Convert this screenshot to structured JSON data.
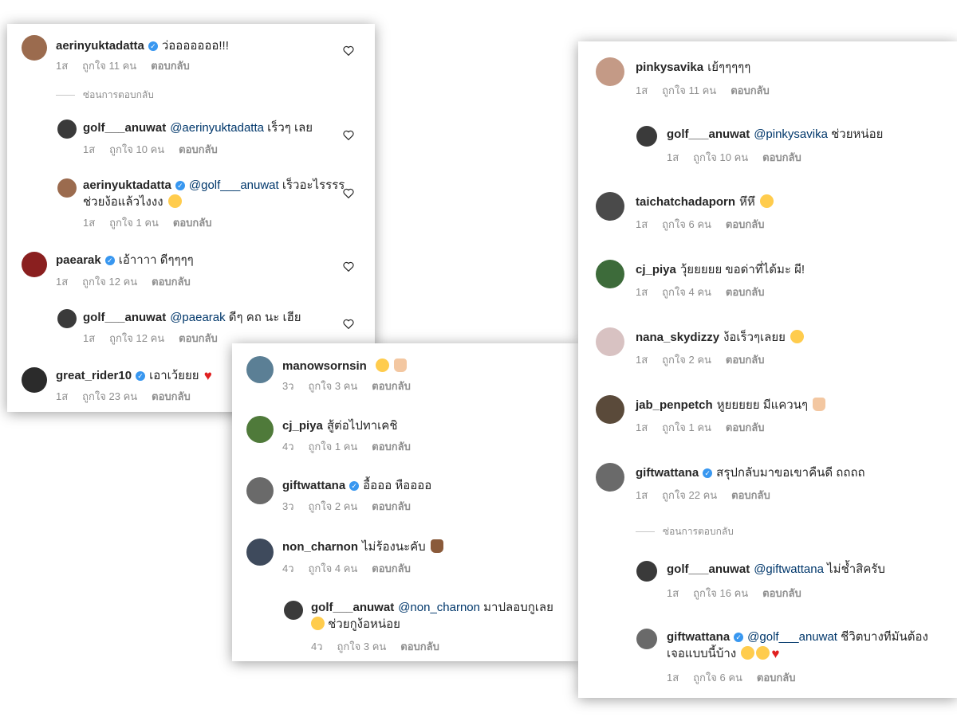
{
  "colors": {
    "verified": "#3897f0",
    "mention": "#00376b",
    "meta": "#8e8e8e",
    "heart_red": "#e02020"
  },
  "panel_a": {
    "c1": {
      "user": "aerinyuktadatta",
      "text": "ว่อออออออ!!!",
      "time": "1ส",
      "likes": "ถูกใจ 11 คน",
      "reply": "ตอบกลับ"
    },
    "hide_replies": "ซ่อนการตอบกลับ",
    "c2": {
      "user": "golf___anuwat",
      "mention": "@aerinyuktadatta",
      "text": "เร็วๆ เลย",
      "time": "1ส",
      "likes": "ถูกใจ 10 คน",
      "reply": "ตอบกลับ"
    },
    "c3": {
      "user": "aerinyuktadatta",
      "mention": "@golf___anuwat",
      "text": "เร็วอะไรรรร ช่วยง้อแล้วไงงง",
      "time": "1ส",
      "likes": "ถูกใจ 1 คน",
      "reply": "ตอบกลับ"
    },
    "c4": {
      "user": "paearak",
      "text": "เอ้าาาา ดีๆๆๆๆ",
      "time": "1ส",
      "likes": "ถูกใจ 12 คน",
      "reply": "ตอบกลับ"
    },
    "c5": {
      "user": "golf___anuwat",
      "mention": "@paearak",
      "text": "ดีๆ คถ นะ เฮีย",
      "time": "1ส",
      "likes": "ถูกใจ 12 คน",
      "reply": "ตอบกลับ"
    },
    "c6": {
      "user": "great_rider10",
      "text": "เอาเว้ยยย",
      "time": "1ส",
      "likes": "ถูกใจ 23 คน",
      "reply": "ตอบกลับ"
    }
  },
  "panel_b": {
    "c1": {
      "user": "manowsornsin",
      "time": "3ว",
      "likes": "ถูกใจ 3 คน",
      "reply": "ตอบกลับ"
    },
    "c2": {
      "user": "cj_piya",
      "text": "สู้ต่อไปทาเคชิ",
      "time": "4ว",
      "likes": "ถูกใจ 1 คน",
      "reply": "ตอบกลับ"
    },
    "c3": {
      "user": "giftwattana",
      "text": "อื้อออ หืออออ",
      "time": "3ว",
      "likes": "ถูกใจ 2 คน",
      "reply": "ตอบกลับ"
    },
    "c4": {
      "user": "non_charnon",
      "text": "ไม่ร้องนะคับ",
      "time": "4ว",
      "likes": "ถูกใจ 4 คน",
      "reply": "ตอบกลับ"
    },
    "c5": {
      "user": "golf___anuwat",
      "mention": "@non_charnon",
      "text": "มาปลอบกูเลย",
      "text2": "ช่วยกูง้อหน่อย",
      "time": "4ว",
      "likes": "ถูกใจ 3 คน",
      "reply": "ตอบกลับ"
    }
  },
  "panel_c": {
    "c1": {
      "user": "pinkysavika",
      "text": "เย้ๆๆๆๆๆ",
      "time": "1ส",
      "likes": "ถูกใจ 11 คน",
      "reply": "ตอบกลับ"
    },
    "c2": {
      "user": "golf___anuwat",
      "mention": "@pinkysavika",
      "text": "ช่วยหน่อย",
      "time": "1ส",
      "likes": "ถูกใจ 10 คน",
      "reply": "ตอบกลับ"
    },
    "c3": {
      "user": "taichatchadaporn",
      "text": "หึหึ",
      "time": "1ส",
      "likes": "ถูกใจ 6 คน",
      "reply": "ตอบกลับ"
    },
    "c4": {
      "user": "cj_piya",
      "text": "วุ้ยยยยย ขอด่าที่ได้มะ ผี!",
      "time": "1ส",
      "likes": "ถูกใจ 4 คน",
      "reply": "ตอบกลับ"
    },
    "c5": {
      "user": "nana_skydizzy",
      "text": "ง้อเร็วๆเลยย",
      "time": "1ส",
      "likes": "ถูกใจ 2 คน",
      "reply": "ตอบกลับ"
    },
    "c6": {
      "user": "jab_penpetch",
      "text": "หูยยยยย มีแควนๆ",
      "time": "1ส",
      "likes": "ถูกใจ 1 คน",
      "reply": "ตอบกลับ"
    },
    "c7": {
      "user": "giftwattana",
      "text": "สรุปกลับมาขอเขาคืนดี ถถถถ",
      "time": "1ส",
      "likes": "ถูกใจ 22 คน",
      "reply": "ตอบกลับ"
    },
    "hide_replies": "ซ่อนการตอบกลับ",
    "c8": {
      "user": "golf___anuwat",
      "mention": "@giftwattana",
      "text": "ไม่ช้ำสิครับ",
      "time": "1ส",
      "likes": "ถูกใจ 16 คน",
      "reply": "ตอบกลับ"
    },
    "c9": {
      "user": "giftwattana",
      "mention": "@golf___anuwat",
      "text": "ชีวิตบางทีมันต้องเจอแบบนี้บ้าง",
      "time": "1ส",
      "likes": "ถูกใจ 6 คน",
      "reply": "ตอบกลับ"
    }
  }
}
